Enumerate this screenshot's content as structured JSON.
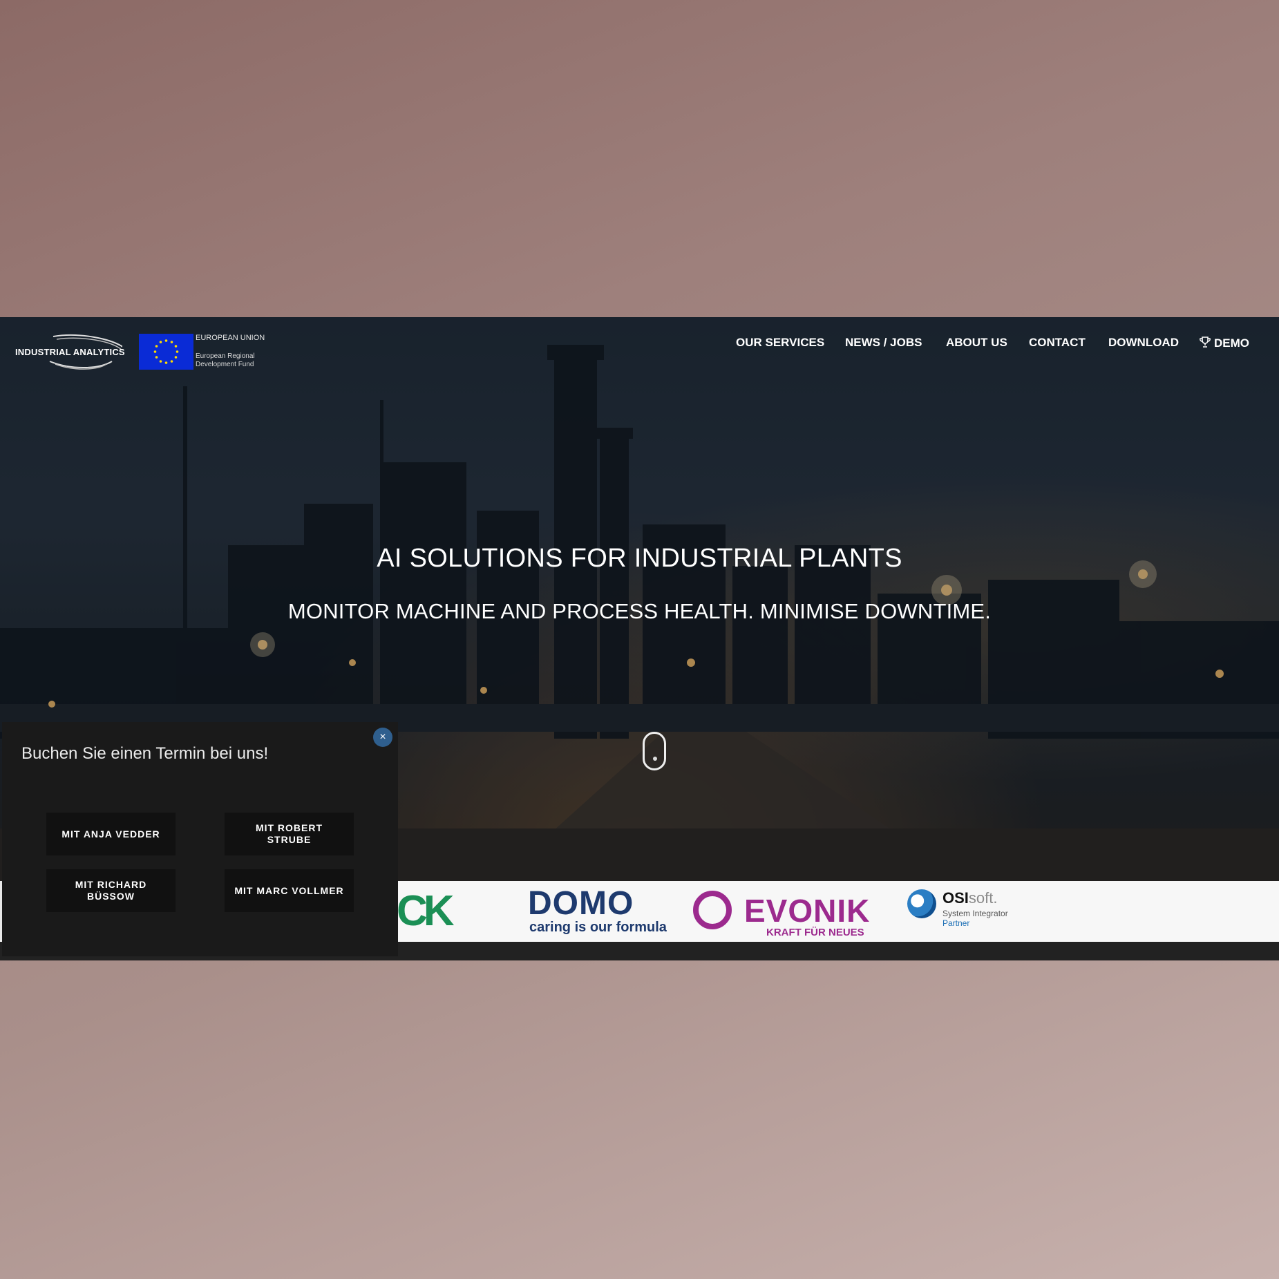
{
  "header": {
    "logo_text": "INDUSTRIAL ANALYTICS",
    "eu": {
      "title": "EUROPEAN UNION",
      "subtitle": "European Regional Development Fund"
    }
  },
  "nav": {
    "items": [
      {
        "label": "OUR SERVICES"
      },
      {
        "label": "NEWS / JOBS"
      },
      {
        "label": "ABOUT US"
      },
      {
        "label": "CONTACT"
      },
      {
        "label": "DOWNLOAD"
      },
      {
        "label": "DEMO",
        "icon": "trophy-icon"
      }
    ],
    "language_icon": "german-flag-icon"
  },
  "hero": {
    "title": "AI SOLUTIONS FOR INDUSTRIAL PLANTS",
    "subtitle": "MONITOR MACHINE AND PROCESS HEALTH. MINIMISE DOWNTIME."
  },
  "partners": {
    "ck": "CK",
    "domo": {
      "name": "DOMO",
      "tagline": "caring is our formula"
    },
    "evonik": {
      "name": "EVONIK",
      "tagline": "KRAFT FÜR NEUES"
    },
    "osisoft": {
      "name_bold": "OSI",
      "name_light": "soft.",
      "line1": "System Integrator",
      "line2": "Partner"
    }
  },
  "popup": {
    "title": "Buchen Sie einen Termin bei uns!",
    "close_label": "×",
    "buttons": [
      {
        "label": "MIT ANJA VEDDER"
      },
      {
        "label": "MIT ROBERT STRUBE"
      },
      {
        "label": "MIT RICHARD BÜSSOW"
      },
      {
        "label": "MIT MARC VOLLMER"
      }
    ]
  },
  "colors": {
    "backdrop": "#9e807c",
    "popup_bg": "#1a1a1a",
    "button_bg": "#111111",
    "close_button": "#2f5f8e",
    "eu_blue": "#0a2bd6",
    "domo_blue": "#1e3a6e",
    "evonik_purple": "#9c2a8e",
    "ck_green": "#1b8f55"
  }
}
